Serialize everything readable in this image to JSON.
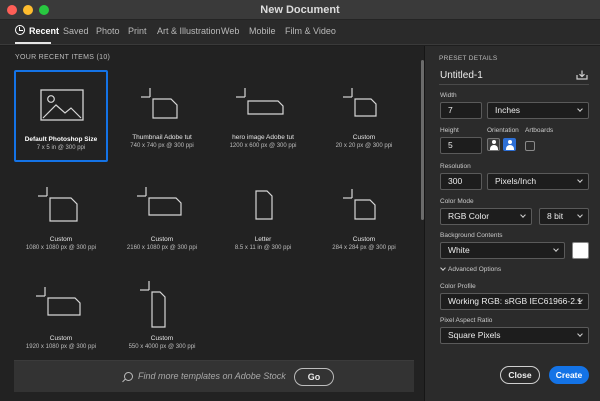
{
  "window": {
    "title": "New Document"
  },
  "tabs": [
    {
      "label": "Recent"
    },
    {
      "label": "Saved"
    },
    {
      "label": "Photo"
    },
    {
      "label": "Print"
    },
    {
      "label": "Art & Illustration"
    },
    {
      "label": "Web"
    },
    {
      "label": "Mobile"
    },
    {
      "label": "Film & Video"
    }
  ],
  "recent": {
    "heading": "YOUR RECENT ITEMS",
    "count": "(10)",
    "items": [
      {
        "name": "Default Photoshop Size",
        "size": "7 x 5 in @ 300 ppi",
        "icon": "photo-document-icon",
        "selected": true
      },
      {
        "name": "Thumbnail Adobe tut",
        "size": "740 x 740 px @ 300 ppi",
        "icon": "blank-document-icon"
      },
      {
        "name": "hero image Adobe tut",
        "size": "1200 x 600 px @ 300 ppi",
        "icon": "blank-document-icon"
      },
      {
        "name": "Custom",
        "size": "20 x 20 px @ 300 ppi",
        "icon": "blank-document-icon"
      },
      {
        "name": "Custom",
        "size": "1080 x 1080 px @ 300 ppi",
        "icon": "blank-document-icon"
      },
      {
        "name": "Custom",
        "size": "2160 x 1080 px @ 300 ppi",
        "icon": "blank-document-icon"
      },
      {
        "name": "Letter",
        "size": "8.5 x 11 in @ 300 ppi",
        "icon": "blank-document-icon"
      },
      {
        "name": "Custom",
        "size": "284 x 284 px @ 300 ppi",
        "icon": "blank-document-icon"
      },
      {
        "name": "Custom",
        "size": "1920 x 1080 px @ 300 ppi",
        "icon": "blank-document-icon"
      },
      {
        "name": "Custom",
        "size": "550 x 4000 px @ 300 ppi",
        "icon": "blank-document-icon"
      }
    ]
  },
  "search": {
    "placeholder": "Find more templates on Adobe Stock",
    "go_label": "Go"
  },
  "preset": {
    "heading": "PRESET DETAILS",
    "name": "Untitled-1",
    "width_label": "Width",
    "width_value": "7",
    "width_unit": "Inches",
    "height_label": "Height",
    "height_value": "5",
    "orientation_label": "Orientation",
    "artboards_label": "Artboards",
    "resolution_label": "Resolution",
    "resolution_value": "300",
    "resolution_unit": "Pixels/Inch",
    "color_mode_label": "Color Mode",
    "color_mode_value": "RGB Color",
    "bit_depth": "8 bit",
    "background_label": "Background Contents",
    "background_value": "White",
    "advanced_label": "Advanced Options",
    "color_profile_label": "Color Profile",
    "color_profile_value": "Working RGB: sRGB IEC61966-2.1",
    "pixel_aspect_label": "Pixel Aspect Ratio",
    "pixel_aspect_value": "Square Pixels"
  },
  "actions": {
    "close_label": "Close",
    "create_label": "Create"
  },
  "colors": {
    "accent": "#1473e6",
    "panel": "#2b2b2b",
    "background": "#222222"
  }
}
